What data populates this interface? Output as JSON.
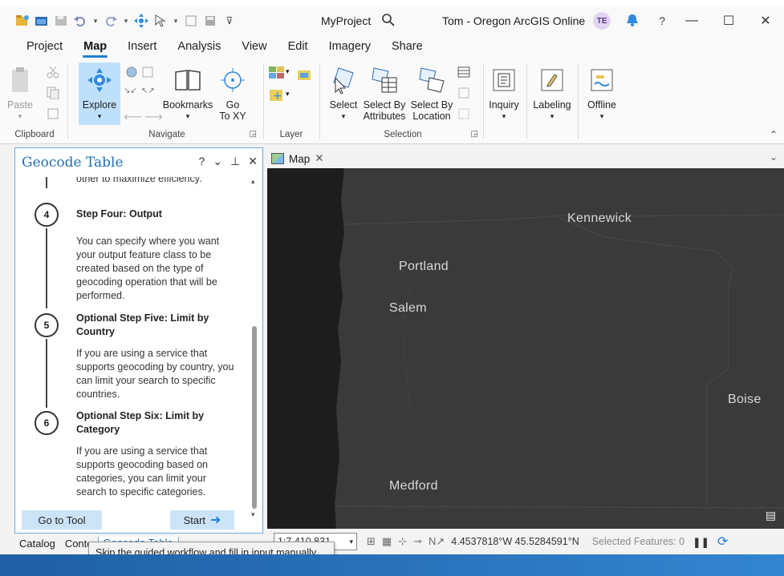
{
  "window": {
    "project_name": "MyProject",
    "user": "Tom - Oregon ArcGIS Online",
    "avatar_initials": "TE",
    "help": "?",
    "minimize": "—",
    "maximize": "☐",
    "close": "✕"
  },
  "ribbon_tabs": [
    "Project",
    "Map",
    "Insert",
    "Analysis",
    "View",
    "Edit",
    "Imagery",
    "Share"
  ],
  "ribbon": {
    "clipboard": {
      "paste": "Paste",
      "label": "Clipboard"
    },
    "navigate": {
      "explore": "Explore",
      "bookmarks": "Bookmarks",
      "go_to_xy": "Go\nTo XY",
      "label": "Navigate"
    },
    "layer": {
      "label": "Layer"
    },
    "selection": {
      "select": "Select",
      "select_by_attributes": "Select By\nAttributes",
      "select_by_location": "Select By\nLocation",
      "label": "Selection"
    },
    "inquiry": "Inquiry",
    "labeling": "Labeling",
    "offline": "Offline"
  },
  "pane": {
    "title": "Geocode Table",
    "truncated_text": "other to maximize efficiency.",
    "steps": [
      {
        "number": "4",
        "title": "Step Four: Output",
        "text": "You can specify where you want your output feature class to be created based on the type of geocoding operation that will be performed."
      },
      {
        "number": "5",
        "title": "Optional Step Five: Limit by Country",
        "text": "If you are using a service that supports geocoding by country, you can limit your search to specific countries."
      },
      {
        "number": "6",
        "title": "Optional Step Six: Limit by Category",
        "text": "If you are using a service that supports geocoding based on categories, you can limit your search to specific categories."
      }
    ],
    "go_to_tool": "Go to Tool",
    "start": "Start"
  },
  "bottom_tabs": [
    "Catalog",
    "Conte",
    "Geocode Table"
  ],
  "tooltip": "Skip the guided workflow and fill in input manually directly in the tool.",
  "map": {
    "tab_label": "Map",
    "labels": [
      {
        "name": "Kennewick"
      },
      {
        "name": "Portland"
      },
      {
        "name": "Salem"
      },
      {
        "name": "Boise"
      },
      {
        "name": "Medford"
      }
    ]
  },
  "status": {
    "scale": "1:7,410,831",
    "coordinates": "4.4537818°W 45.5284591°N",
    "selected_features": "Selected Features: 0"
  },
  "colors": {
    "accent": "#1e7fd6",
    "map_background": "#3a3a3a",
    "water": "#1d1d1d",
    "pane_title": "#1c6fb8"
  }
}
